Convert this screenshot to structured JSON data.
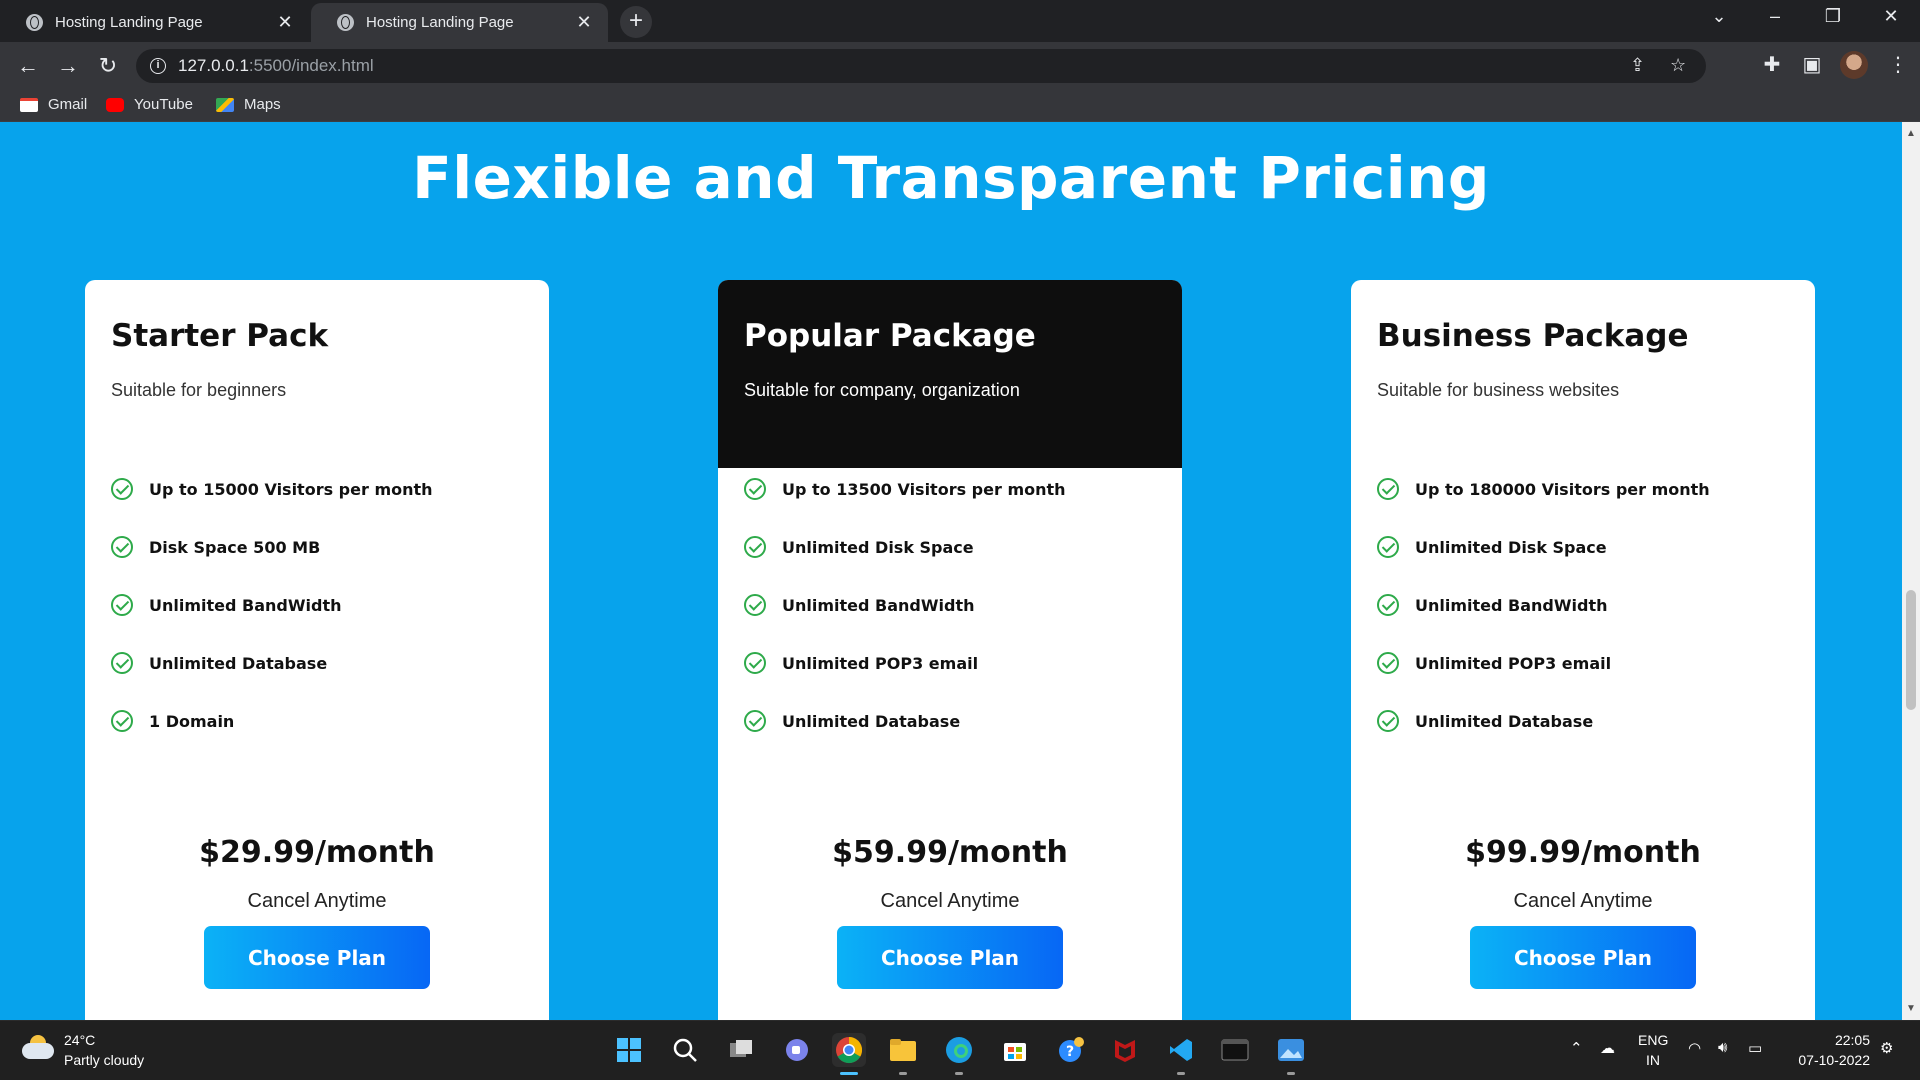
{
  "browser": {
    "tabs": [
      {
        "title": "Hosting Landing Page",
        "active": false
      },
      {
        "title": "Hosting Landing Page",
        "active": true
      }
    ],
    "new_tab": "+",
    "url_host": "127.0.0.1",
    "url_path": ":5500/index.html",
    "bookmarks": [
      {
        "label": "Gmail",
        "icon": "gmail-icon"
      },
      {
        "label": "YouTube",
        "icon": "youtube-icon"
      },
      {
        "label": "Maps",
        "icon": "maps-icon"
      }
    ]
  },
  "page": {
    "title": "Flexible and Transparent Pricing",
    "plans": [
      {
        "name": "Starter Pack",
        "subtitle": "Suitable for beginners",
        "features": [
          "Up to 15000 Visitors per month",
          "Disk Space 500 MB",
          "Unlimited BandWidth",
          "Unlimited Database",
          "1 Domain"
        ],
        "price": "$29.99/month",
        "note": "Cancel Anytime",
        "cta": "Choose Plan"
      },
      {
        "name": "Popular Package",
        "subtitle": "Suitable for company, organization",
        "features": [
          "Up to 13500 Visitors per month",
          "Unlimited Disk Space",
          "Unlimited BandWidth",
          "Unlimited POP3 email",
          "Unlimited Database"
        ],
        "price": "$59.99/month",
        "note": "Cancel Anytime",
        "cta": "Choose Plan"
      },
      {
        "name": "Business Package",
        "subtitle": "Suitable for business websites",
        "features": [
          "Up to 180000 Visitors per month",
          "Unlimited Disk Space",
          "Unlimited BandWidth",
          "Unlimited POP3 email",
          "Unlimited Database"
        ],
        "price": "$99.99/month",
        "note": "Cancel Anytime",
        "cta": "Choose Plan"
      }
    ]
  },
  "taskbar": {
    "weather_temp": "24°C",
    "weather_desc": "Partly cloudy",
    "lang_top": "ENG",
    "lang_bottom": "IN",
    "time": "22:05",
    "date": "07-10-2022"
  },
  "colors": {
    "page_bg": "#07a3ec",
    "popular_header": "#0e0e0e",
    "check": "#2eaa4a",
    "button_from": "#0bb2f6",
    "button_to": "#0767f5"
  }
}
